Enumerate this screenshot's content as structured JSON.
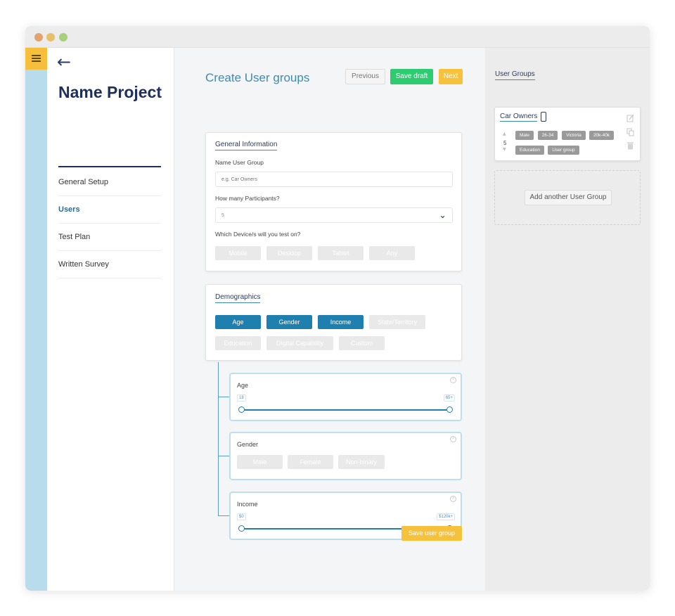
{
  "sidebar": {
    "project_title": "Name Project",
    "nav": [
      "General Setup",
      "Users",
      "Test Plan",
      "Written Survey"
    ]
  },
  "header": {
    "title": "Create User groups",
    "previous_label": "Previous",
    "save_draft_label": "Save draft",
    "next_label": "Next"
  },
  "general": {
    "title": "General Information",
    "name_label": "Name User Group",
    "name_placeholder": "e.g. Car Owners",
    "participants_label": "How many Participants?",
    "participants_value": "5",
    "devices_label": "Which Device/s will you test on?",
    "devices": [
      "Mobile",
      "Desktop",
      "Tablet",
      "Any"
    ]
  },
  "demographics": {
    "title": "Demographics",
    "options": [
      "Age",
      "Gender",
      "Income",
      "State/Territory",
      "Education",
      "Digital Capability",
      "Custom"
    ],
    "selected": [
      "Age",
      "Gender",
      "Income"
    ]
  },
  "age": {
    "title": "Age",
    "min": "18",
    "max": "65+"
  },
  "gender": {
    "title": "Gender",
    "options": [
      "Male",
      "Female",
      "Non-binary"
    ]
  },
  "income": {
    "title": "Income",
    "min": "$0",
    "max": "$120k+"
  },
  "save_group_label": "Save user group",
  "right_panel": {
    "title": "User Groups",
    "group": {
      "name": "Car Owners",
      "count": "5",
      "tags": [
        "Male",
        "26-34",
        "Victoria",
        "20k-40k",
        "Education",
        "User group"
      ]
    },
    "add_label": "Add another User Group"
  },
  "colors": {
    "accent": "#1f7fae",
    "save_draft": "#2ecc71",
    "next": "#f6c13b",
    "rail": "#b9dced"
  }
}
